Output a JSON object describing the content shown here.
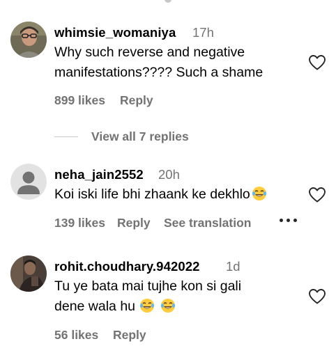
{
  "comments": [
    {
      "username": "whimsie_womaniya",
      "time": "17h",
      "text": "Why such reverse and negative manifestations???? Such a shame",
      "likes": "899 likes",
      "reply": "Reply"
    },
    {
      "username": "neha_jain2552",
      "time": "20h",
      "text": "Koi iski life bhi zhaank ke dekhlo",
      "emoji": "face-with-tears-of-joy",
      "likes": "139 likes",
      "reply": "Reply",
      "translation": "See translation"
    },
    {
      "username": "rohit.choudhary.942022",
      "time": "1d",
      "text_line1": "Tu ye bata mai tujhe kon si gali",
      "text_line2": "dene wala hu",
      "emojis": [
        "face-with-tears-of-joy",
        "face-with-tears-of-joy"
      ],
      "likes": "56 likes",
      "reply": "Reply"
    }
  ],
  "view_replies": "View all 7 replies",
  "colors": {
    "secondary_text": "#737373",
    "primary_text": "#000000",
    "background": "#ffffff"
  }
}
